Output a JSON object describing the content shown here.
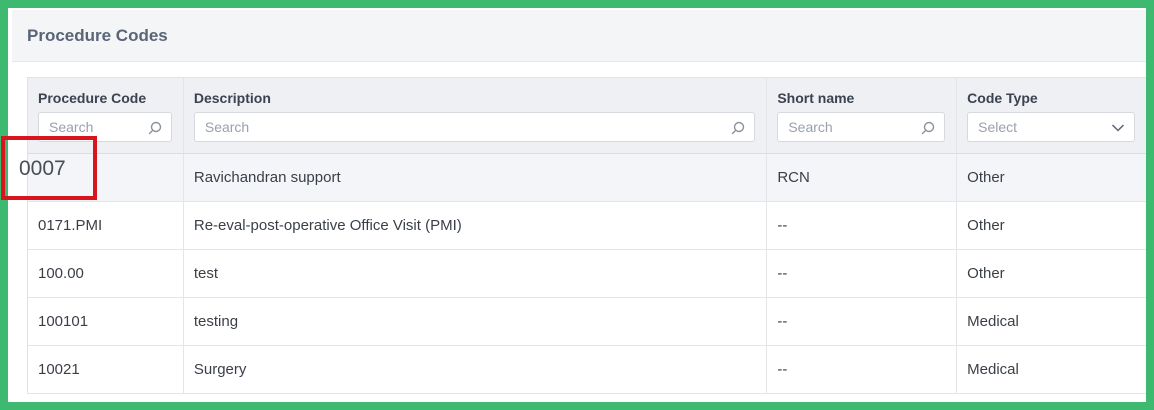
{
  "panel": {
    "title": "Procedure Codes"
  },
  "columns": [
    {
      "label": "Procedure Code",
      "filter_placeholder": "Search",
      "filter_type": "search"
    },
    {
      "label": "Description",
      "filter_placeholder": "Search",
      "filter_type": "search"
    },
    {
      "label": "Short name",
      "filter_placeholder": "Search",
      "filter_type": "search"
    },
    {
      "label": "Code Type",
      "filter_placeholder": "Select",
      "filter_type": "select"
    }
  ],
  "rows": [
    {
      "code": "",
      "description": "Ravichandran support",
      "short_name": "RCN",
      "code_type": "Other"
    },
    {
      "code": "0171.PMI",
      "description": "Re-eval-post-operative Office Visit (PMI)",
      "short_name": "--",
      "code_type": "Other"
    },
    {
      "code": "100.00",
      "description": "test",
      "short_name": "--",
      "code_type": "Other"
    },
    {
      "code": "100101",
      "description": "testing",
      "short_name": "--",
      "code_type": "Medical"
    },
    {
      "code": "10021",
      "description": "Surgery",
      "short_name": "--",
      "code_type": "Medical"
    }
  ],
  "highlighted_code": "0007",
  "colors": {
    "border": "#3dba6f",
    "highlight": "#d8141c"
  },
  "icons": {
    "search": "search-icon",
    "dropdown": "chevron-down-icon"
  }
}
